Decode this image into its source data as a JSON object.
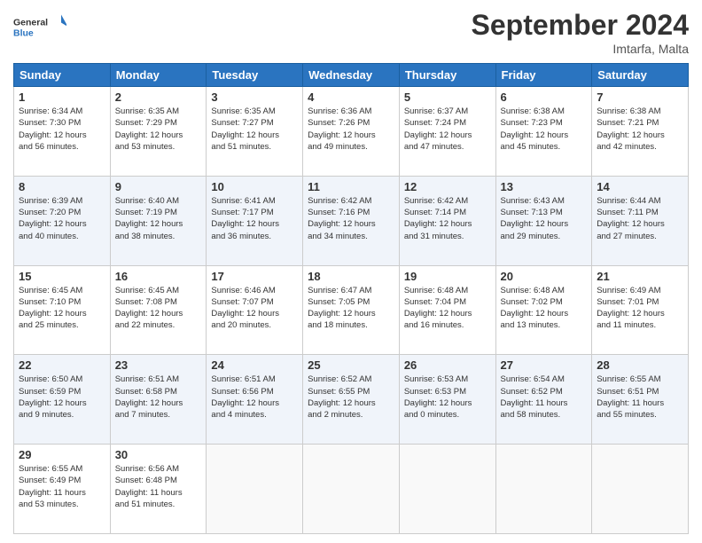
{
  "header": {
    "logo_line1": "General",
    "logo_line2": "Blue",
    "month_title": "September 2024",
    "location": "Imtarfa, Malta"
  },
  "days_of_week": [
    "Sunday",
    "Monday",
    "Tuesday",
    "Wednesday",
    "Thursday",
    "Friday",
    "Saturday"
  ],
  "weeks": [
    [
      {
        "day": "1",
        "info": "Sunrise: 6:34 AM\nSunset: 7:30 PM\nDaylight: 12 hours\nand 56 minutes."
      },
      {
        "day": "2",
        "info": "Sunrise: 6:35 AM\nSunset: 7:29 PM\nDaylight: 12 hours\nand 53 minutes."
      },
      {
        "day": "3",
        "info": "Sunrise: 6:35 AM\nSunset: 7:27 PM\nDaylight: 12 hours\nand 51 minutes."
      },
      {
        "day": "4",
        "info": "Sunrise: 6:36 AM\nSunset: 7:26 PM\nDaylight: 12 hours\nand 49 minutes."
      },
      {
        "day": "5",
        "info": "Sunrise: 6:37 AM\nSunset: 7:24 PM\nDaylight: 12 hours\nand 47 minutes."
      },
      {
        "day": "6",
        "info": "Sunrise: 6:38 AM\nSunset: 7:23 PM\nDaylight: 12 hours\nand 45 minutes."
      },
      {
        "day": "7",
        "info": "Sunrise: 6:38 AM\nSunset: 7:21 PM\nDaylight: 12 hours\nand 42 minutes."
      }
    ],
    [
      {
        "day": "8",
        "info": "Sunrise: 6:39 AM\nSunset: 7:20 PM\nDaylight: 12 hours\nand 40 minutes."
      },
      {
        "day": "9",
        "info": "Sunrise: 6:40 AM\nSunset: 7:19 PM\nDaylight: 12 hours\nand 38 minutes."
      },
      {
        "day": "10",
        "info": "Sunrise: 6:41 AM\nSunset: 7:17 PM\nDaylight: 12 hours\nand 36 minutes."
      },
      {
        "day": "11",
        "info": "Sunrise: 6:42 AM\nSunset: 7:16 PM\nDaylight: 12 hours\nand 34 minutes."
      },
      {
        "day": "12",
        "info": "Sunrise: 6:42 AM\nSunset: 7:14 PM\nDaylight: 12 hours\nand 31 minutes."
      },
      {
        "day": "13",
        "info": "Sunrise: 6:43 AM\nSunset: 7:13 PM\nDaylight: 12 hours\nand 29 minutes."
      },
      {
        "day": "14",
        "info": "Sunrise: 6:44 AM\nSunset: 7:11 PM\nDaylight: 12 hours\nand 27 minutes."
      }
    ],
    [
      {
        "day": "15",
        "info": "Sunrise: 6:45 AM\nSunset: 7:10 PM\nDaylight: 12 hours\nand 25 minutes."
      },
      {
        "day": "16",
        "info": "Sunrise: 6:45 AM\nSunset: 7:08 PM\nDaylight: 12 hours\nand 22 minutes."
      },
      {
        "day": "17",
        "info": "Sunrise: 6:46 AM\nSunset: 7:07 PM\nDaylight: 12 hours\nand 20 minutes."
      },
      {
        "day": "18",
        "info": "Sunrise: 6:47 AM\nSunset: 7:05 PM\nDaylight: 12 hours\nand 18 minutes."
      },
      {
        "day": "19",
        "info": "Sunrise: 6:48 AM\nSunset: 7:04 PM\nDaylight: 12 hours\nand 16 minutes."
      },
      {
        "day": "20",
        "info": "Sunrise: 6:48 AM\nSunset: 7:02 PM\nDaylight: 12 hours\nand 13 minutes."
      },
      {
        "day": "21",
        "info": "Sunrise: 6:49 AM\nSunset: 7:01 PM\nDaylight: 12 hours\nand 11 minutes."
      }
    ],
    [
      {
        "day": "22",
        "info": "Sunrise: 6:50 AM\nSunset: 6:59 PM\nDaylight: 12 hours\nand 9 minutes."
      },
      {
        "day": "23",
        "info": "Sunrise: 6:51 AM\nSunset: 6:58 PM\nDaylight: 12 hours\nand 7 minutes."
      },
      {
        "day": "24",
        "info": "Sunrise: 6:51 AM\nSunset: 6:56 PM\nDaylight: 12 hours\nand 4 minutes."
      },
      {
        "day": "25",
        "info": "Sunrise: 6:52 AM\nSunset: 6:55 PM\nDaylight: 12 hours\nand 2 minutes."
      },
      {
        "day": "26",
        "info": "Sunrise: 6:53 AM\nSunset: 6:53 PM\nDaylight: 12 hours\nand 0 minutes."
      },
      {
        "day": "27",
        "info": "Sunrise: 6:54 AM\nSunset: 6:52 PM\nDaylight: 11 hours\nand 58 minutes."
      },
      {
        "day": "28",
        "info": "Sunrise: 6:55 AM\nSunset: 6:51 PM\nDaylight: 11 hours\nand 55 minutes."
      }
    ],
    [
      {
        "day": "29",
        "info": "Sunrise: 6:55 AM\nSunset: 6:49 PM\nDaylight: 11 hours\nand 53 minutes."
      },
      {
        "day": "30",
        "info": "Sunrise: 6:56 AM\nSunset: 6:48 PM\nDaylight: 11 hours\nand 51 minutes."
      },
      {
        "day": "",
        "info": ""
      },
      {
        "day": "",
        "info": ""
      },
      {
        "day": "",
        "info": ""
      },
      {
        "day": "",
        "info": ""
      },
      {
        "day": "",
        "info": ""
      }
    ]
  ]
}
